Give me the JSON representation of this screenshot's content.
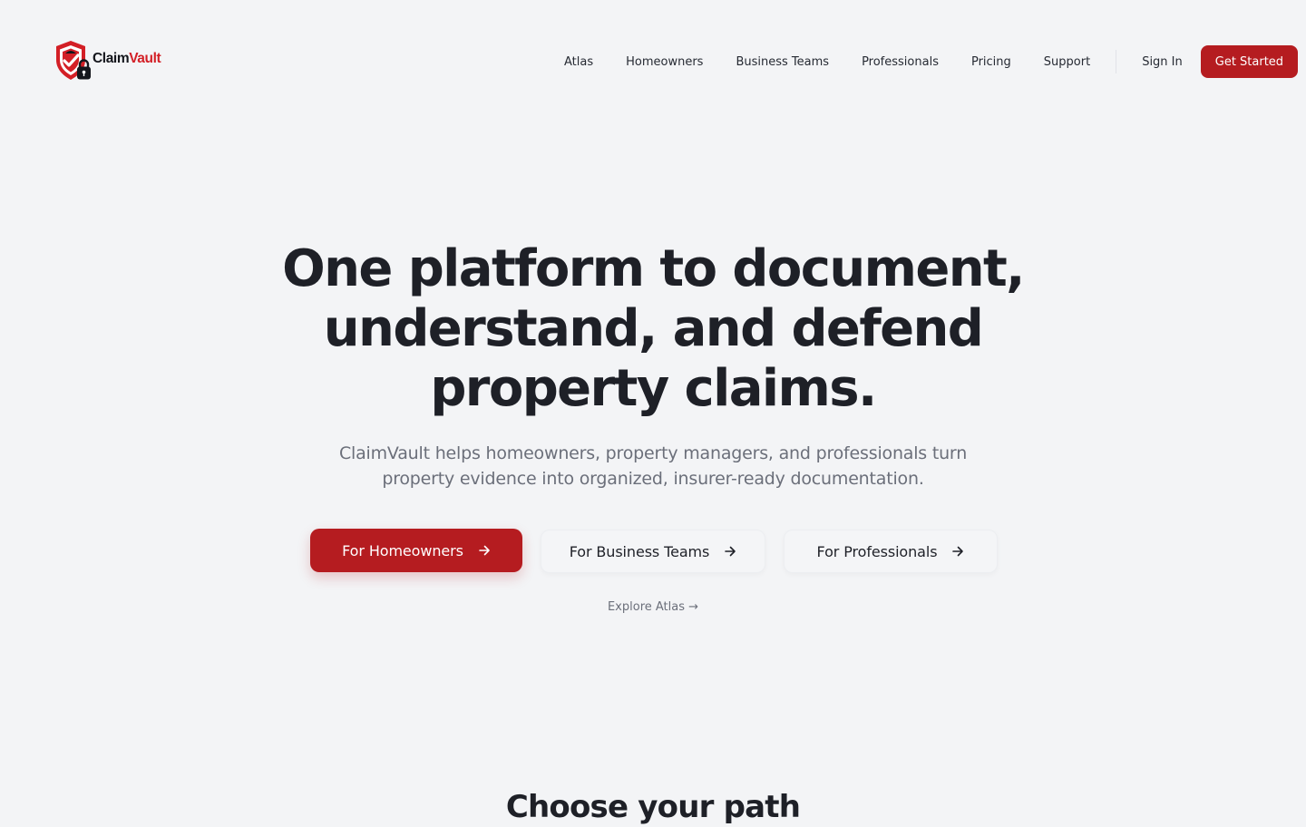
{
  "brand": {
    "name_part1": "Claim",
    "name_part2": "Vault",
    "logo_icon": "shield-check-lock-icon",
    "accent_color": "#b51c20"
  },
  "nav": {
    "links": [
      "Atlas",
      "Homeowners",
      "Business Teams",
      "Professionals",
      "Pricing",
      "Support"
    ],
    "sign_in": "Sign In",
    "get_started": "Get Started"
  },
  "hero": {
    "title_line1": "One platform to document,",
    "title_line2": "understand, and defend",
    "title_line3": "property claims.",
    "subtitle_line1": "ClaimVault helps homeowners, property managers, and professionals turn",
    "subtitle_line2": "property evidence into organized, insurer-ready documentation.",
    "cta_homeowners": "For Homeowners",
    "cta_business": "For Business Teams",
    "cta_professionals": "For Professionals",
    "cta_icon": "arrow-right-icon",
    "explore": "Explore Atlas →"
  },
  "section": {
    "title": "Choose your path"
  }
}
